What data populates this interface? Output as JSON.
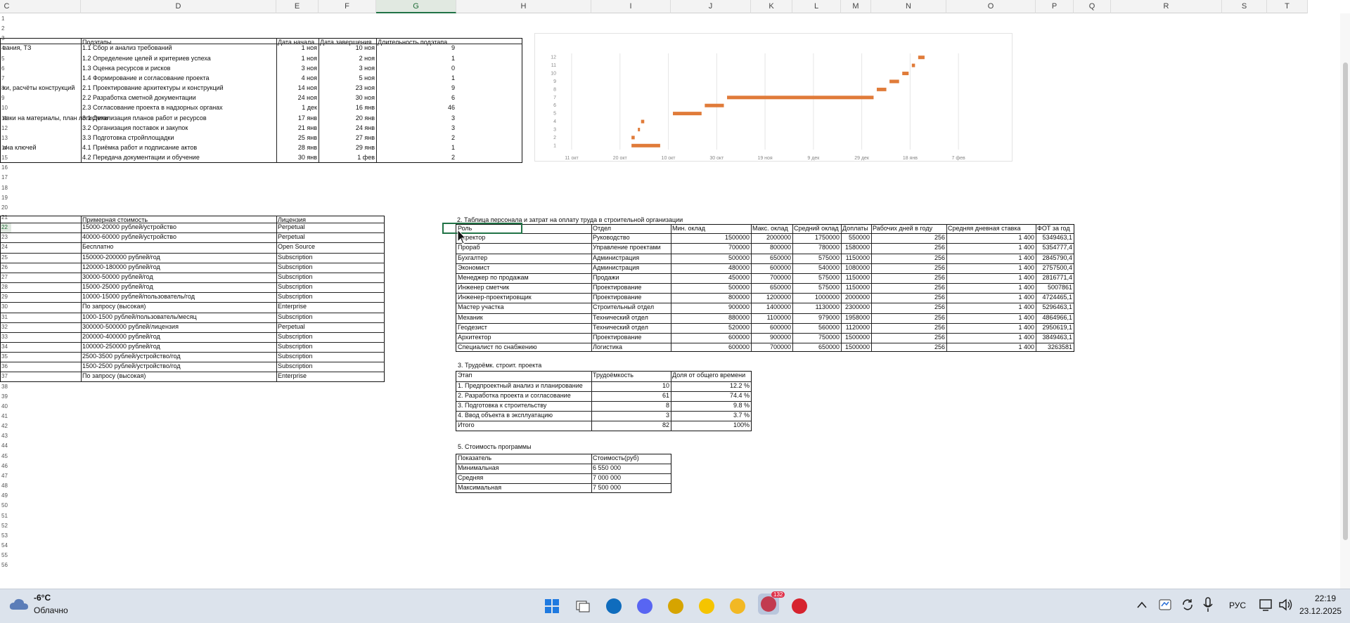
{
  "sheet": {
    "columns": [
      {
        "label": "C",
        "w": 210
      },
      {
        "label": "D",
        "w": 278
      },
      {
        "label": "E",
        "w": 60
      },
      {
        "label": "F",
        "w": 82
      },
      {
        "label": "G",
        "w": 114
      },
      {
        "label": "H",
        "w": 192
      },
      {
        "label": "I",
        "w": 113
      },
      {
        "label": "J",
        "w": 114
      },
      {
        "label": "K",
        "w": 59
      },
      {
        "label": "L",
        "w": 69
      },
      {
        "label": "M",
        "w": 43
      },
      {
        "label": "N",
        "w": 107
      },
      {
        "label": "O",
        "w": 127
      },
      {
        "label": "P",
        "w": 54
      },
      {
        "label": "Q",
        "w": 53
      },
      {
        "label": "R",
        "w": 158
      },
      {
        "label": "S",
        "w": 64
      },
      {
        "label": "T",
        "w": 58
      }
    ],
    "selected_column": "G",
    "rows": [
      1,
      2,
      3,
      4,
      5,
      6,
      7,
      8,
      9,
      10,
      11,
      12,
      13,
      14,
      15,
      16,
      17,
      18,
      19,
      20,
      21,
      22,
      23,
      24,
      25,
      26,
      27,
      28,
      29,
      30,
      31,
      32,
      33,
      34,
      35,
      36,
      37,
      38,
      39,
      40,
      41,
      42,
      43,
      44,
      45,
      46,
      47,
      48,
      49,
      50,
      51,
      52,
      53,
      54,
      55,
      56
    ],
    "selected_row": 22
  },
  "stages": {
    "headers": [
      "Подэтапы",
      "Дата начала",
      "Дата завершения",
      "Длительность подэтапа"
    ],
    "rows": [
      {
        "row": 4,
        "stage": "вания, ТЗ",
        "sub": "1.1 Сбор и анализ требований",
        "start": "1 ноя",
        "end": "10 ноя",
        "dur": "9"
      },
      {
        "row": 5,
        "stage": "",
        "sub": "1.2 Определение целей и критериев успеха",
        "start": "1 ноя",
        "end": "2 ноя",
        "dur": "1"
      },
      {
        "row": 6,
        "stage": "",
        "sub": "1.3 Оценка ресурсов и рисков",
        "start": "3 ноя",
        "end": "3 ноя",
        "dur": "0"
      },
      {
        "row": 7,
        "stage": "",
        "sub": "1.4 Формирование и согласование проекта",
        "start": "4 ноя",
        "end": "5 ноя",
        "dur": "1"
      },
      {
        "row": 8,
        "stage": "ки, расчёты конструкций",
        "sub": "2.1 Проектирование архитектуры и конструкций",
        "start": "14 ноя",
        "end": "23 ноя",
        "dur": "9"
      },
      {
        "row": 9,
        "stage": "",
        "sub": "2.2 Разработка сметной документации",
        "start": "24 ноя",
        "end": "30 ноя",
        "dur": "6"
      },
      {
        "row": 10,
        "stage": "",
        "sub": "2.3 Согласование проекта в надзорных органах",
        "start": "1 дек",
        "end": "16 янв",
        "dur": "46"
      },
      {
        "row": 11,
        "stage": "явки на материалы, план логистики",
        "sub": "3.1 Детализация планов работ и ресурсов",
        "start": "17 янв",
        "end": "20 янв",
        "dur": "3"
      },
      {
        "row": 12,
        "stage": "",
        "sub": "3.2 Организация поставок и закупок",
        "start": "21 янв",
        "end": "24 янв",
        "dur": "3"
      },
      {
        "row": 13,
        "stage": "",
        "sub": "3.3 Подготовка стройплощадки",
        "start": "25 янв",
        "end": "27 янв",
        "dur": "2"
      },
      {
        "row": 14,
        "stage": "ача ключей",
        "sub": "4.1 Приёмка работ и подписание актов",
        "start": "28 янв",
        "end": "29 янв",
        "dur": "1"
      },
      {
        "row": 15,
        "stage": "",
        "sub": "4.2 Передача документации и обучение",
        "start": "30 янв",
        "end": "1 фев",
        "dur": "2"
      }
    ]
  },
  "software": {
    "headers": [
      "Примерная стоимость",
      "Лицензия"
    ],
    "rows": [
      [
        "15000-20000 рублей/устройство",
        "Perpetual"
      ],
      [
        "40000-60000 рублей/устройство",
        "Perpetual"
      ],
      [
        "Бесплатно",
        "Open Source"
      ],
      [
        "150000-200000 рублей/год",
        "Subscription"
      ],
      [
        "120000-180000 рублей/год",
        "Subscription"
      ],
      [
        "30000-50000 рублей/год",
        "Subscription"
      ],
      [
        "15000-25000 рублей/год",
        "Subscription"
      ],
      [
        "10000-15000 рублей/пользователь/год",
        "Subscription"
      ],
      [
        "По запросу (высокая)",
        "Enterprise"
      ],
      [
        "1000-1500 рублей/пользователь/месяц",
        "Subscription"
      ],
      [
        "300000-500000 рублей/лицензия",
        "Perpetual"
      ],
      [
        "200000-400000 рублей/год",
        "Subscription"
      ],
      [
        "100000-250000 рублей/год",
        "Subscription"
      ],
      [
        "2500-3500 рублей/устройство/год",
        "Subscription"
      ],
      [
        "1500-2500 рублей/устройство/год",
        "Subscription"
      ],
      [
        "По запросу (высокая)",
        "Enterprise"
      ]
    ]
  },
  "staff": {
    "title": "2. Таблица персонала и затрат на оплату труда в строительной организации",
    "headers": [
      "Роль",
      "Отдел",
      "Мин. оклад",
      "Макс. оклад",
      "Средний оклад",
      "Доплаты",
      "Рабочих дней в году",
      "Средняя дневная ставка",
      "ФОТ за год"
    ],
    "rows": [
      [
        "Директор",
        "Руководство",
        "1500000",
        "2000000",
        "1750000",
        "550000",
        "256",
        "1 400",
        "5349463,1"
      ],
      [
        "Прораб",
        "Управление проектами",
        "700000",
        "800000",
        "780000",
        "1580000",
        "256",
        "1 400",
        "5354777,4"
      ],
      [
        "Бухгалтер",
        "Администрация",
        "500000",
        "650000",
        "575000",
        "1150000",
        "256",
        "1 400",
        "2845790,4"
      ],
      [
        "Экономист",
        "Администрация",
        "480000",
        "600000",
        "540000",
        "1080000",
        "256",
        "1 400",
        "2757500,4"
      ],
      [
        "Менеджер по продажам",
        "Продажи",
        "450000",
        "700000",
        "575000",
        "1150000",
        "256",
        "1 400",
        "2816771,4"
      ],
      [
        "Инженер сметчик",
        "Проектирование",
        "500000",
        "650000",
        "575000",
        "1150000",
        "256",
        "1 400",
        "5007861"
      ],
      [
        "Инженер-проектировщик",
        "Проектирование",
        "800000",
        "1200000",
        "1000000",
        "2000000",
        "256",
        "1 400",
        "4724465,1"
      ],
      [
        "Мастер участка",
        "Строительный отдел",
        "900000",
        "1400000",
        "1130000",
        "2300000",
        "256",
        "1 400",
        "5296463,1"
      ],
      [
        "Механик",
        "Технический отдел",
        "880000",
        "1100000",
        "979000",
        "1958000",
        "256",
        "1 400",
        "4864966,1"
      ],
      [
        "Геодезист",
        "Технический отдел",
        "520000",
        "600000",
        "560000",
        "1120000",
        "256",
        "1 400",
        "2950619,1"
      ],
      [
        "Архитектор",
        "Проектирование",
        "600000",
        "900000",
        "750000",
        "1500000",
        "256",
        "1 400",
        "3849463,1"
      ],
      [
        "Специалист по снабжению",
        "Логистика",
        "600000",
        "700000",
        "650000",
        "1500000",
        "256",
        "1 400",
        "3263581"
      ]
    ]
  },
  "labor": {
    "title": "3. Трудоёмк. строит. проекта",
    "headers": [
      "Этап",
      "Трудоёмкость",
      "Доля от общего времени"
    ],
    "rows": [
      [
        "1. Предпроектный анализ и планирование",
        "10",
        "12.2 %"
      ],
      [
        "2. Разработка проекта и согласование",
        "61",
        "74.4 %"
      ],
      [
        "3. Подготовка к строительству",
        "8",
        "9.8 %"
      ],
      [
        "4. Ввод объекта в эксплуатацию",
        "3",
        "3.7 %"
      ],
      [
        "Итого",
        "82",
        "100%"
      ]
    ]
  },
  "cost": {
    "title": "5. Стоимость программы",
    "headers": [
      "Показатель",
      "Стоимость(руб)"
    ],
    "rows": [
      [
        "Минимальная",
        "6 550 000"
      ],
      [
        "Средняя",
        "7 000 000"
      ],
      [
        "Максимальная",
        "7 500 000"
      ]
    ]
  },
  "chart_data": {
    "type": "bar",
    "subtype": "gantt",
    "color": "#e07b39",
    "x_tick_labels": [
      "11 окт",
      "20 окт",
      "10 окт",
      "30 окт",
      "19 ноя",
      "9 дек",
      "29 дек",
      "18 янв",
      "7 фев"
    ],
    "y_tick_labels": [
      "1",
      "2",
      "3",
      "4",
      "5",
      "6",
      "7",
      "8",
      "9",
      "10",
      "11",
      "12"
    ],
    "tasks": [
      {
        "row": 1,
        "start": "2024-11-01",
        "end": "2024-11-10"
      },
      {
        "row": 2,
        "start": "2024-11-01",
        "end": "2024-11-02"
      },
      {
        "row": 3,
        "start": "2024-11-03",
        "end": "2024-11-03"
      },
      {
        "row": 4,
        "start": "2024-11-04",
        "end": "2024-11-05"
      },
      {
        "row": 5,
        "start": "2024-11-14",
        "end": "2024-11-23"
      },
      {
        "row": 6,
        "start": "2024-11-24",
        "end": "2024-11-30"
      },
      {
        "row": 7,
        "start": "2024-12-01",
        "end": "2025-01-16"
      },
      {
        "row": 8,
        "start": "2025-01-17",
        "end": "2025-01-20"
      },
      {
        "row": 9,
        "start": "2025-01-21",
        "end": "2025-01-24"
      },
      {
        "row": 10,
        "start": "2025-01-25",
        "end": "2025-01-27"
      },
      {
        "row": 11,
        "start": "2025-01-28",
        "end": "2025-01-29"
      },
      {
        "row": 12,
        "start": "2025-01-30",
        "end": "2025-02-01"
      }
    ]
  },
  "taskbar": {
    "weather_temp": "-6°C",
    "weather_desc": "Облачно",
    "lang": "РУС",
    "time": "22:19",
    "date": "23.12.2025",
    "badge": "132",
    "apps": [
      "windows-start",
      "task-view",
      "edge",
      "discord",
      "file-app",
      "winamp",
      "explorer",
      "telegram",
      "wps"
    ]
  }
}
